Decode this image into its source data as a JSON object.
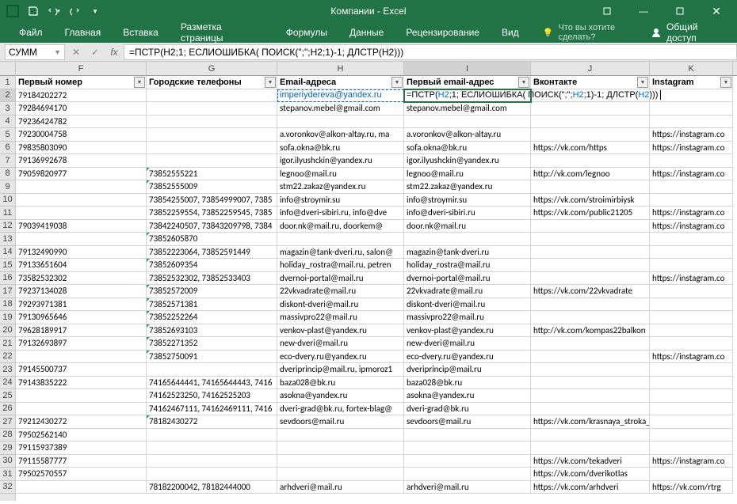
{
  "title": "Компании - Excel",
  "qat": {
    "icons": [
      "excel",
      "save",
      "undo",
      "redo",
      "touch"
    ]
  },
  "tabs": [
    "Файл",
    "Главная",
    "Вставка",
    "Разметка страницы",
    "Формулы",
    "Данные",
    "Рецензирование",
    "Вид"
  ],
  "tell_me": {
    "placeholder": "Что вы хотите сделать?"
  },
  "share": "Общий доступ",
  "namebox": "СУММ",
  "formula": {
    "prefix": "=ПСТР(H2;1; ЕСЛИОШИБКА( ПОИСК(\";\";H2;1)-1; ДЛСТР(H2)))",
    "ref": "H2"
  },
  "formula_display": "=ПСТР(H2;1; ЕСЛИОШИБКА( ПОИСК(\";\";H2;1)-1; ДЛСТР(H2)))",
  "columns": [
    "F",
    "G",
    "H",
    "I",
    "J",
    "K"
  ],
  "col_widths": [
    "colF",
    "colG",
    "colH",
    "colI",
    "colJ",
    "colK"
  ],
  "headers": [
    "Первый номер",
    "Городские телефоны",
    "Email-адреса",
    "Первый email-адрес",
    "Вконтакте",
    "Instagram"
  ],
  "rows": [
    {
      "n": 1,
      "hdr": true
    },
    {
      "n": 2,
      "f": "79184202272",
      "g": "",
      "h": "imperiydereva@yandex.ru",
      "i": "=ПСТР(H2;1; ЕСЛИОШИБКА( ПОИСК(\";\";H2;1)-1; ДЛСТР(H2)))",
      "j": "",
      "k": "",
      "edit": true,
      "link_h": true
    },
    {
      "n": 3,
      "f": "79284694170",
      "g": "",
      "h": "stepanov.mebel@gmail.com",
      "i": "stepanov.mebel@gmail.com",
      "j": "",
      "k": ""
    },
    {
      "n": 4,
      "f": "79236424782",
      "g": "",
      "h": "",
      "i": "",
      "j": "",
      "k": ""
    },
    {
      "n": 5,
      "f": "79230004758",
      "g": "",
      "h": "a.voronkov@alkon-altay.ru, ma",
      "i": "a.voronkov@alkon-altay.ru",
      "j": "",
      "k": "https://instagram.co"
    },
    {
      "n": 6,
      "f": "79835803090",
      "g": "",
      "h": "sofa.okna@bk.ru",
      "i": "sofa.okna@bk.ru",
      "j": "https://vk.com/https",
      "k": "https://instagram.co"
    },
    {
      "n": 7,
      "f": "79136992678",
      "g": "",
      "h": "igor.ilyushckin@yandex.ru",
      "i": "igor.ilyushckin@yandex.ru",
      "j": "",
      "k": ""
    },
    {
      "n": 8,
      "f": "79059820977",
      "g": "73852555221",
      "h": "legnoo@mail.ru",
      "i": "legnoo@mail.ru",
      "j": "http://vk.com/legnoo",
      "k": "https://instagram.co",
      "gt": true
    },
    {
      "n": 9,
      "f": "",
      "g": "73852555009",
      "h": "stm22.zakaz@yandex.ru",
      "i": "stm22.zakaz@yandex.ru",
      "j": "",
      "k": "",
      "gt": true
    },
    {
      "n": 10,
      "f": "",
      "g": "73854255007, 73854999007, 7385",
      "h": "info@stroymir.su",
      "i": "info@stroymir.su",
      "j": "https://vk.com/stroimirbiysk",
      "k": ""
    },
    {
      "n": 11,
      "f": "",
      "g": "73852259554, 73852259545, 7385",
      "h": "info@dveri-sibiri.ru, info@dve",
      "i": "info@dveri-sibiri.ru",
      "j": "https://vk.com/public21205",
      "k": "https://instagram.co"
    },
    {
      "n": 12,
      "f": "79039419038",
      "g": "73842240507, 73843209798, 7384",
      "h": "door.nk@mail.ru, doorkem@",
      "i": "door.nk@mail.ru",
      "j": "",
      "k": "https://instagram.co"
    },
    {
      "n": 13,
      "f": "",
      "g": "73852605870",
      "h": "",
      "i": "",
      "j": "",
      "k": "",
      "gt": true
    },
    {
      "n": 14,
      "f": "79132490990",
      "g": "73852223064, 73852591449",
      "h": "magazin@tank-dveri.ru, salon@",
      "i": "magazin@tank-dveri.ru",
      "j": "",
      "k": ""
    },
    {
      "n": 15,
      "f": "79133651604",
      "g": "73852609354",
      "h": "holiday_rostra@mail.ru, petren",
      "i": "holiday_rostra@mail.ru",
      "j": "",
      "k": "",
      "gt": true
    },
    {
      "n": 16,
      "f": "73582532302",
      "g": "73852532302, 73852533403",
      "h": "dvernoi-portal@mail.ru",
      "i": "dvernoi-portal@mail.ru",
      "j": "",
      "k": "https://instagram.co"
    },
    {
      "n": 17,
      "f": "79237134028",
      "g": "73852572009",
      "h": "22vkvadrate@mail.ru",
      "i": "22vkvadrate@mail.ru",
      "j": "https://vk.com/22vkvadrate",
      "k": "",
      "gt": true
    },
    {
      "n": 18,
      "f": "79293971381",
      "g": "73852571381",
      "h": "diskont-dveri@mail.ru",
      "i": "diskont-dveri@mail.ru",
      "j": "",
      "k": "",
      "gt": true
    },
    {
      "n": 19,
      "f": "79130965646",
      "g": "73852252264",
      "h": "massivpro22@mail.ru",
      "i": "massivpro22@mail.ru",
      "j": "",
      "k": "",
      "gt": true
    },
    {
      "n": 20,
      "f": "79628189917",
      "g": "73852693103",
      "h": "venkov-plast@yandex.ru",
      "i": "venkov-plast@yandex.ru",
      "j": "http://vk.com/kompas22balkon",
      "k": "",
      "gt": true
    },
    {
      "n": 21,
      "f": "79132693897",
      "g": "73852271352",
      "h": "new-dveri@mail.ru",
      "i": "new-dveri@mail.ru",
      "j": "",
      "k": "",
      "gt": true
    },
    {
      "n": 22,
      "f": "",
      "g": "73852750091",
      "h": "eco-dvery.ru@yandex.ru",
      "i": "eco-dvery.ru@yandex.ru",
      "j": "",
      "k": "https://instagram.co",
      "gt": true
    },
    {
      "n": 23,
      "f": "79145500737",
      "g": "",
      "h": "dveriprincip@mail.ru, ipmoroz1",
      "i": "dveriprincip@mail.ru",
      "j": "",
      "k": ""
    },
    {
      "n": 24,
      "f": "79143835222",
      "g": "74165644441, 74165644443, 7416",
      "h": "baza028@bk.ru",
      "i": "baza028@bk.ru",
      "j": "",
      "k": ""
    },
    {
      "n": 25,
      "f": "",
      "g": "74162523250, 74162525203",
      "h": "asokna@yandex.ru",
      "i": "asokna@yandex.ru",
      "j": "",
      "k": ""
    },
    {
      "n": 26,
      "f": "",
      "g": "74162467111, 74162469111, 7416",
      "h": "dveri-grad@bk.ru, fortex-blag@",
      "i": "dveri-grad@bk.ru",
      "j": "",
      "k": ""
    },
    {
      "n": 27,
      "f": "79212430272",
      "g": "78182430272",
      "h": "sevdoors@mail.ru",
      "i": "sevdoors@mail.ru",
      "j": "https://vk.com/krasnaya_stroka_arh",
      "k": "",
      "gt": true
    },
    {
      "n": 28,
      "f": "79502562140",
      "g": "",
      "h": "",
      "i": "",
      "j": "",
      "k": ""
    },
    {
      "n": 29,
      "f": "79115937389",
      "g": "",
      "h": "",
      "i": "",
      "j": "",
      "k": ""
    },
    {
      "n": 30,
      "f": "79115587777",
      "g": "",
      "h": "",
      "i": "",
      "j": "https://vk.com/tekadveri",
      "k": "https://instagram.co"
    },
    {
      "n": 31,
      "f": "79502570557",
      "g": "",
      "h": "",
      "i": "",
      "j": "https://vk.com/dverikotlas",
      "k": ""
    },
    {
      "n": 32,
      "f": "",
      "g": "78182200042, 78182444000",
      "h": "arhdveri@mail.ru",
      "i": "arhdveri@mail.ru",
      "j": "https://vk.com/arhdveri",
      "k": "https://vk.com/rtrg"
    }
  ]
}
